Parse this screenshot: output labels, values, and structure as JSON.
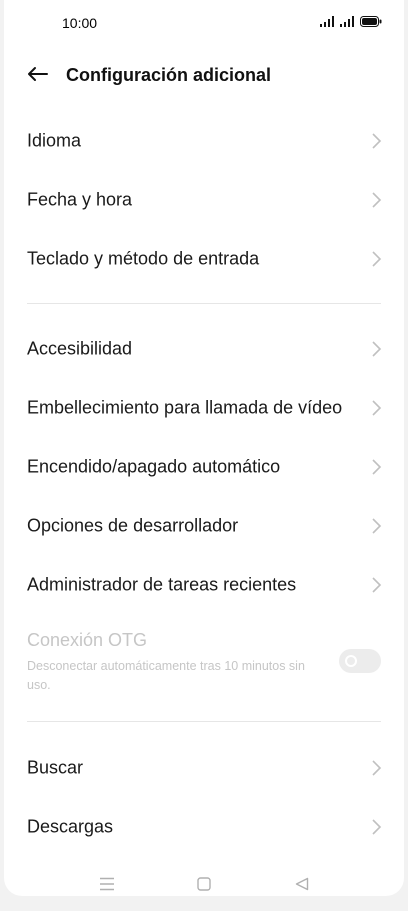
{
  "status_bar": {
    "time": "10:00",
    "icons": [
      "signal-icon",
      "signal-icon",
      "battery-icon"
    ]
  },
  "header": {
    "back_icon": "arrow-left-icon",
    "title": "Configuración adicional"
  },
  "groups": [
    {
      "items": [
        {
          "label": "Idioma"
        },
        {
          "label": "Fecha y hora"
        },
        {
          "label": "Teclado y método de entrada"
        }
      ]
    },
    {
      "items": [
        {
          "label": "Accesibilidad"
        },
        {
          "label": "Embellecimiento para llamada de vídeo"
        },
        {
          "label": "Encendido/apagado automático"
        },
        {
          "label": "Opciones de desarrollador"
        },
        {
          "label": "Administrador de tareas recientes"
        }
      ]
    },
    {
      "items": [
        {
          "label": "Buscar"
        },
        {
          "label": "Descargas"
        }
      ]
    }
  ],
  "otg": {
    "title": "Conexión OTG",
    "subtitle": "Desconectar automáticamente tras 10 minutos sin uso.",
    "enabled": false,
    "disabled_appearance": true
  },
  "nav_bar": {
    "icons": [
      "menu-icon",
      "home-icon",
      "back-triangle-icon"
    ]
  },
  "colors": {
    "text": "#1a1a1a",
    "disabled_text": "#c6c6c6",
    "chevron": "#c0c0c0",
    "divider": "#e6e6e6",
    "background": "#ffffff"
  }
}
